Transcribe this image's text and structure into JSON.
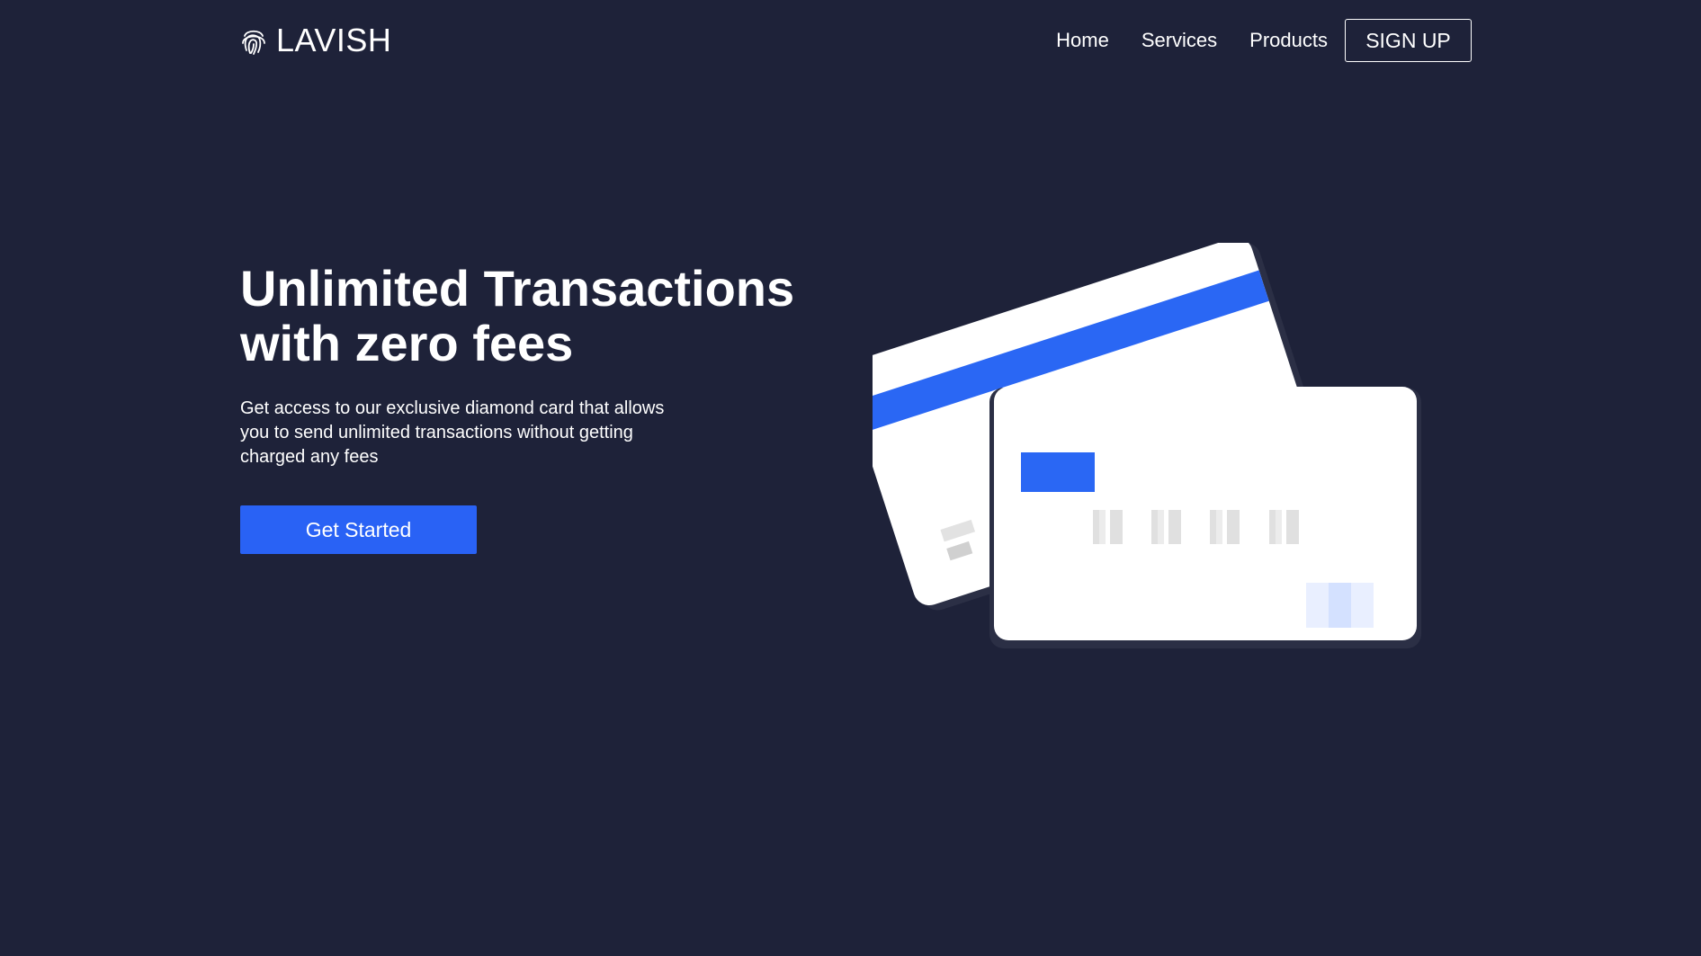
{
  "brand": {
    "name": "LAVISH",
    "icon": "fingerprint-icon"
  },
  "nav": {
    "links": [
      "Home",
      "Services",
      "Products"
    ],
    "signup_label": "SIGN UP"
  },
  "hero": {
    "title_line1": "Unlimited Transactions",
    "title_line2": "with zero fees",
    "description": "Get access to our exclusive diamond card that allows you to send unlimited transactions without getting charged any fees",
    "cta_label": "Get Started"
  },
  "colors": {
    "background": "#1e2239",
    "accent": "#2962f5",
    "card": "#ffffff"
  },
  "illustration": {
    "icon": "credit-cards-illustration"
  }
}
